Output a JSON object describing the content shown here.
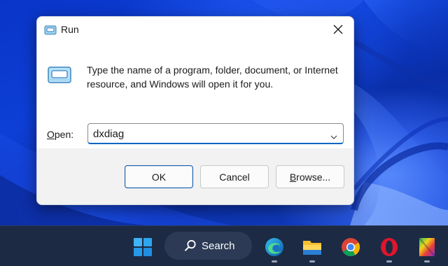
{
  "dialog": {
    "title": "Run",
    "description": "Type the name of a program, folder, document, or Internet resource, and Windows will open it for you.",
    "open_label_accel": "O",
    "open_label_rest": "pen:",
    "open_value": "dxdiag",
    "buttons": {
      "ok": "OK",
      "cancel": "Cancel",
      "browse_accel": "B",
      "browse_rest": "rowse..."
    },
    "icons": {
      "title": "run-icon",
      "main": "run-icon",
      "close": "close-icon",
      "dropdown": "chevron-down-icon"
    }
  },
  "taskbar": {
    "search_label": "Search",
    "items": [
      "start-icon",
      "search-icon",
      "edge-icon",
      "file-explorer-icon",
      "chrome-icon",
      "opera-icon",
      "app-icon"
    ],
    "colors": {
      "background": "#1c2a44",
      "search_pill": "#2c3a55"
    }
  },
  "colors": {
    "accent": "#0067c0",
    "dialog_footer": "#f2f2f2",
    "wallpaper": "#0b35c8"
  }
}
